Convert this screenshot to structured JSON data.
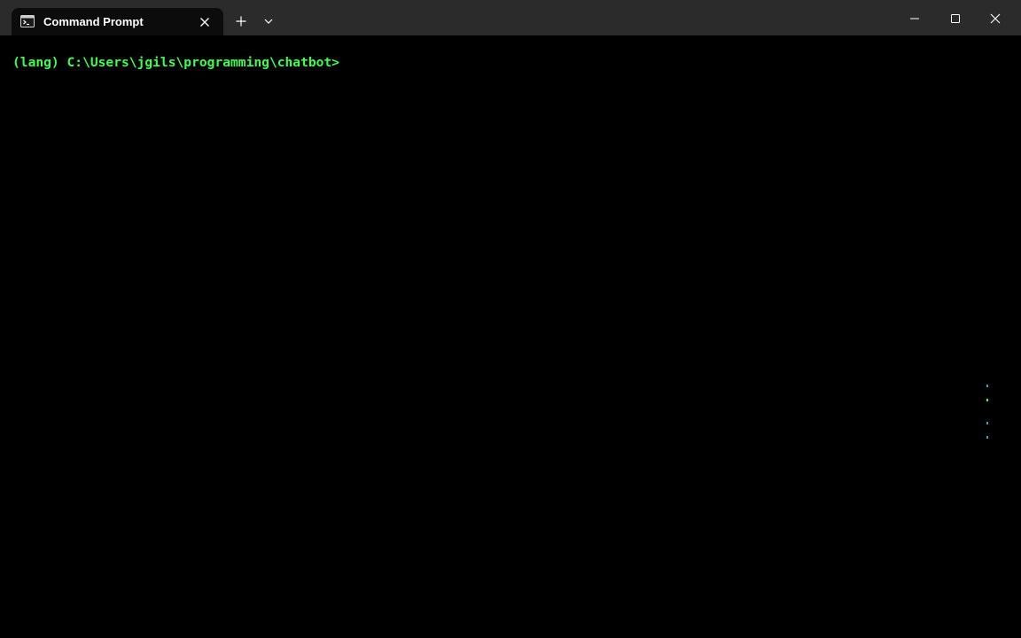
{
  "window": {
    "tab_title": "Command Prompt",
    "tab_icon": "terminal-icon",
    "close_tab_icon": "close-icon",
    "new_tab_icon": "plus-icon",
    "dropdown_icon": "chevron-down-icon",
    "minimize_icon": "minimize-icon",
    "maximize_icon": "maximize-icon",
    "close_window_icon": "close-icon"
  },
  "terminal": {
    "prompt": "(lang) C:\\Users\\jgils\\programming\\chatbot>"
  },
  "colors": {
    "titlebar_bg": "#2b2b2b",
    "tab_bg": "#0c0c0c",
    "terminal_bg": "#000000",
    "prompt_text": "#3bff4f",
    "titlebar_text": "#ffffff"
  }
}
